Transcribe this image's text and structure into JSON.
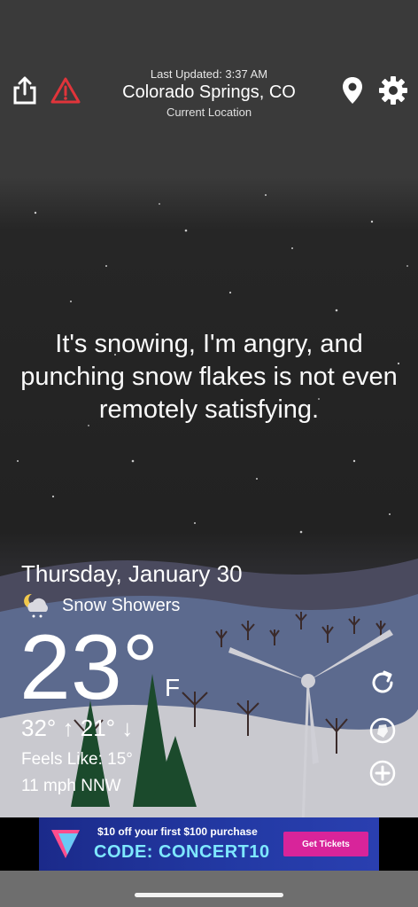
{
  "header": {
    "last_updated": "Last Updated: 3:37 AM",
    "location": "Colorado Springs, CO",
    "location_subtitle": "Current Location",
    "icons": [
      "share-icon",
      "alert-icon",
      "location-pin-icon",
      "gear-icon"
    ]
  },
  "message": "It's snowing, I'm angry, and punching snow flakes is not even remotely satisfying.",
  "weather": {
    "date": "Thursday, January 30",
    "condition": "Snow Showers",
    "condition_icon": "moon-cloud-snow-icon",
    "temperature": "23°",
    "unit": "F",
    "hi_lo": "32° ↑ 21° ↓",
    "feels_like": "Feels Like: 15°",
    "wind": "11 mph NNW"
  },
  "side_buttons": [
    "refresh-icon",
    "radar-icon",
    "add-icon"
  ],
  "ad": {
    "line1": "$10 off your first $100 purchase",
    "line2": "CODE: CONCERT10",
    "button": "Get Tickets"
  },
  "colors": {
    "ad_background": "#233aa5",
    "ad_button": "#d8249a",
    "ad_code_text": "#7ee8ff"
  }
}
